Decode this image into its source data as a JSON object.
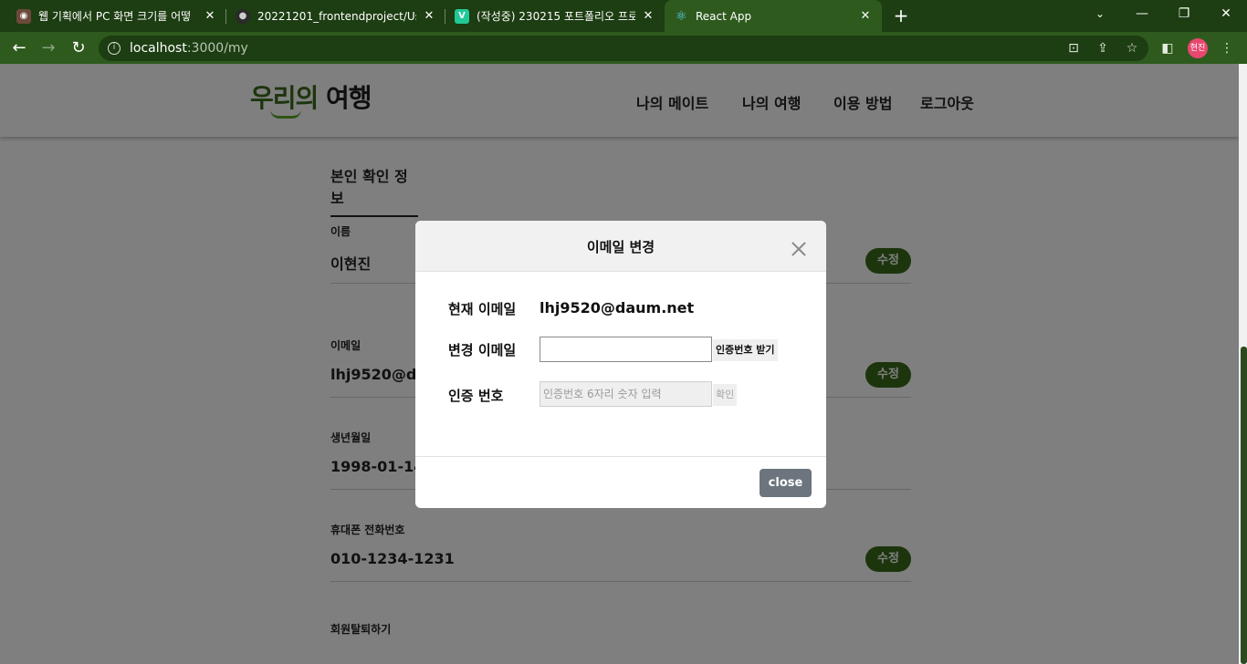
{
  "browser": {
    "tabs": [
      {
        "title": "웹 기획에서 PC 화면 크기를 어떻",
        "favicon": "person-icon"
      },
      {
        "title": "20221201_frontendproject/UserI",
        "favicon": "github-icon"
      },
      {
        "title": "(작성중) 230215 포트폴리오 프로",
        "favicon": "v-icon"
      },
      {
        "title": "React App",
        "favicon": "react-icon"
      }
    ],
    "url_host": "localhost",
    "url_path": ":3000/my",
    "profile_label": "현진"
  },
  "header": {
    "logo_part1": "우리의",
    "logo_part2": " 여행",
    "nav": [
      "나의 메이트",
      "나의 여행",
      "이용 방법",
      "로그아웃"
    ]
  },
  "profile": {
    "section_title": "본인 확인 정보",
    "fields": [
      {
        "label": "이름",
        "value": "이현진",
        "edit": "수정"
      },
      {
        "label": "이메일",
        "value": "lhj9520@daum.net",
        "edit": "수정"
      },
      {
        "label": "생년월일",
        "value": "1998-01-14T",
        "edit": ""
      },
      {
        "label": "휴대폰 전화번호",
        "value": "010-1234-1231",
        "edit": "수정"
      },
      {
        "label": "회원탈퇴하기",
        "value": "",
        "edit": ""
      }
    ]
  },
  "modal": {
    "title": "이메일 변경",
    "current_label": "현재 이메일",
    "current_value": "lhj9520@daum.net",
    "new_label": "변경 이메일",
    "new_value": "",
    "send_code_label": "인증번호 받기",
    "code_label": "인증 번호",
    "code_placeholder": "인증번호 6자리 숫자 입력",
    "confirm_label": "확인",
    "close_label": "close"
  },
  "colors": {
    "brand_green": "#3a6b1a",
    "chrome_dark": "#1d3d12",
    "chrome": "#2e5a1e",
    "close_button": "#6c757d"
  }
}
